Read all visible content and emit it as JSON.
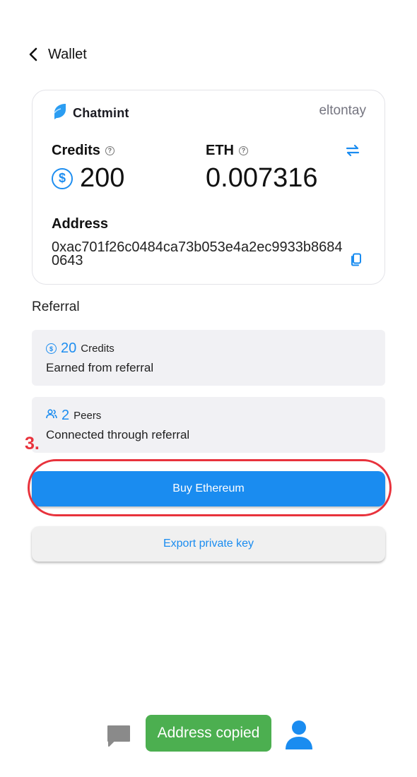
{
  "header": {
    "title": "Wallet"
  },
  "wallet_card": {
    "brand": "Chatmint",
    "username": "eltontay",
    "credits": {
      "label": "Credits",
      "value": "200",
      "coin_symbol": "$"
    },
    "eth": {
      "label": "ETH",
      "value": "0.007316"
    },
    "address": {
      "label": "Address",
      "value": "0xac701f26c0484ca73b053e4a2ec9933b86840643"
    }
  },
  "referral": {
    "title": "Referral",
    "credits": {
      "number": "20",
      "unit": "Credits",
      "description": "Earned from referral"
    },
    "peers": {
      "number": "2",
      "unit": "Peers",
      "description": "Connected through referral"
    }
  },
  "annotation": {
    "step": "3."
  },
  "buttons": {
    "buy": "Buy Ethereum",
    "export": "Export private key"
  },
  "toast": {
    "message": "Address copied"
  },
  "icons": [
    "back-icon",
    "chatmint-logo",
    "help-icon",
    "swap-icon",
    "coin-icon",
    "copy-icon",
    "peers-icon",
    "chat-icon",
    "profile-icon"
  ],
  "colors": {
    "accent": "#1a8cf0",
    "annotation": "#e8323c",
    "toast": "#4caf50",
    "tile_bg": "#f1f1f4"
  }
}
